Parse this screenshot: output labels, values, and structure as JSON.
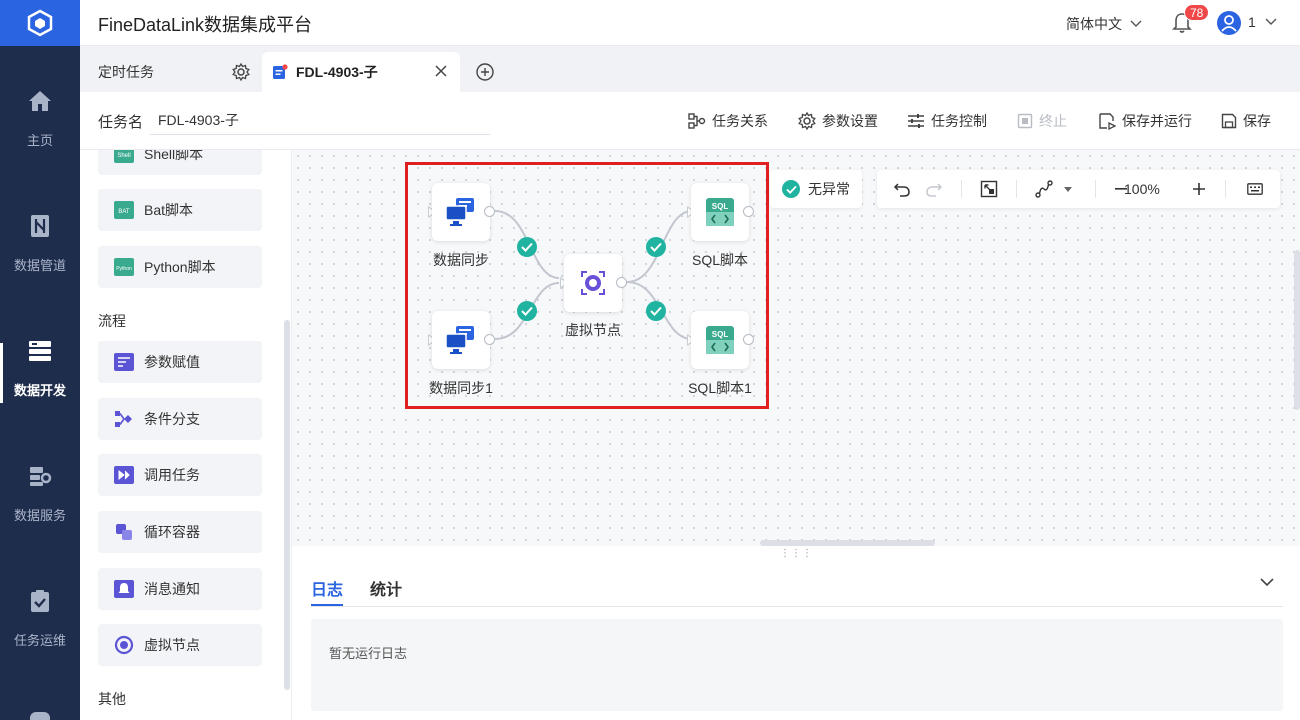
{
  "app": {
    "title": "FineDataLink数据集成平台"
  },
  "header": {
    "language": "简体中文",
    "notification_count": "78",
    "user": "1"
  },
  "nav": {
    "items": [
      {
        "label": "主页",
        "icon": "home-icon"
      },
      {
        "label": "数据管道",
        "icon": "pipeline-icon"
      },
      {
        "label": "数据开发",
        "icon": "dev-icon",
        "active": true
      },
      {
        "label": "数据服务",
        "icon": "service-icon"
      },
      {
        "label": "任务运维",
        "icon": "ops-icon"
      }
    ]
  },
  "tabs": {
    "tab1": "定时任务",
    "tab2": "FDL-4903-子"
  },
  "toolbar": {
    "task_label": "任务名",
    "task_name": "FDL-4903-子",
    "relations": "任务关系",
    "params": "参数设置",
    "control": "任务控制",
    "stop": "终止",
    "save_run": "保存并运行",
    "save": "保存"
  },
  "palette": {
    "items_top": [
      {
        "label": "Shell脚本",
        "badge": "Shell"
      },
      {
        "label": "Bat脚本",
        "badge": "BAT"
      },
      {
        "label": "Python脚本",
        "badge": "Python"
      }
    ],
    "section_flow": "流程",
    "items_flow": [
      {
        "label": "参数赋值"
      },
      {
        "label": "条件分支"
      },
      {
        "label": "调用任务"
      },
      {
        "label": "循环容器"
      },
      {
        "label": "消息通知"
      },
      {
        "label": "虚拟节点"
      }
    ],
    "section_other": "其他"
  },
  "canvas": {
    "status": "无异常",
    "zoom": "100%",
    "nodes": [
      {
        "id": "sync1",
        "label": "数据同步"
      },
      {
        "id": "sync2",
        "label": "数据同步1"
      },
      {
        "id": "virtual",
        "label": "虚拟节点"
      },
      {
        "id": "sql1",
        "label": "SQL脚本",
        "badge": "SQL"
      },
      {
        "id": "sql2",
        "label": "SQL脚本1",
        "badge": "SQL"
      }
    ]
  },
  "bottom": {
    "tab_log": "日志",
    "tab_stats": "统计",
    "empty_log": "暂无运行日志"
  },
  "colors": {
    "primary": "#2b64e0",
    "nav_bg": "#1f2d4d",
    "success": "#20b3a0",
    "highlight": "#e02020",
    "sql_badge": "#3aaa8e"
  }
}
